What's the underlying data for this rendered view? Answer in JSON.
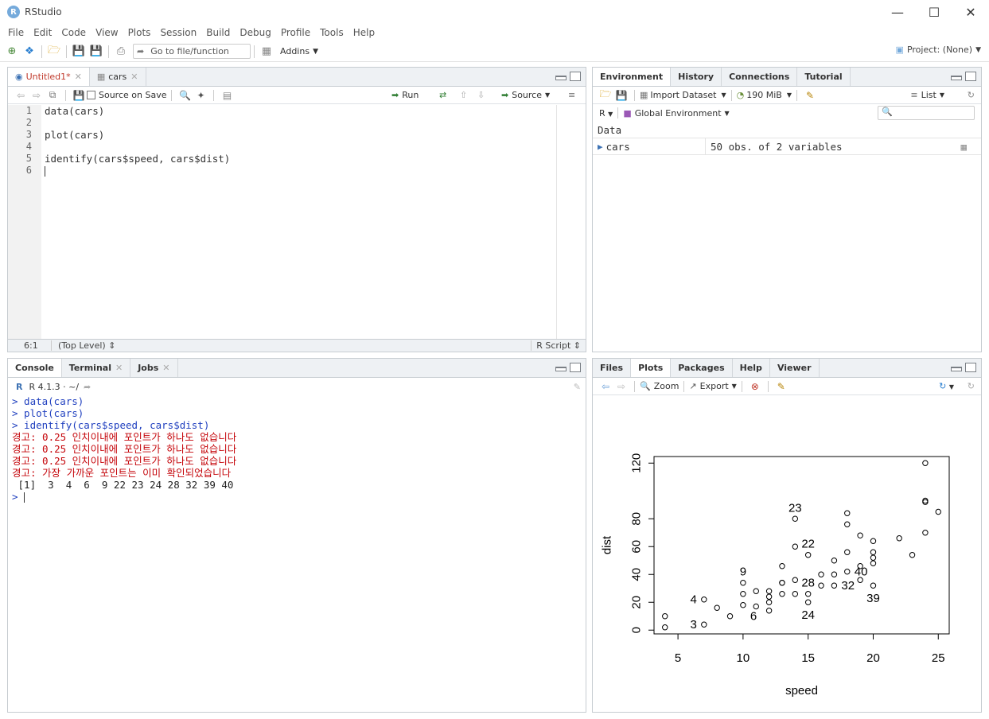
{
  "window": {
    "title": "RStudio",
    "app_icon": "R"
  },
  "menu": [
    "File",
    "Edit",
    "Code",
    "View",
    "Plots",
    "Session",
    "Build",
    "Debug",
    "Profile",
    "Tools",
    "Help"
  ],
  "toolbar": {
    "goto_placeholder": "Go to file/function",
    "addins": "Addins",
    "project": "Project: (None)"
  },
  "source": {
    "tabs": [
      {
        "label": "Untitled1*",
        "active": true
      },
      {
        "label": "cars",
        "active": false
      }
    ],
    "toolbar": {
      "source_on_save": "Source on Save",
      "run": "Run",
      "source": "Source"
    },
    "lines": [
      "data(cars)",
      "",
      "plot(cars)",
      "",
      "identify(cars$speed, cars$dist)",
      ""
    ],
    "line_numbers": [
      "1",
      "2",
      "3",
      "4",
      "5",
      "6"
    ],
    "status": {
      "position": "6:1",
      "scope": "(Top Level)",
      "filetype": "R Script"
    }
  },
  "console": {
    "tabs": [
      "Console",
      "Terminal",
      "Jobs"
    ],
    "header": "R 4.1.3 · ~/",
    "lines": [
      {
        "type": "cmd",
        "text": "> data(cars)"
      },
      {
        "type": "cmd",
        "text": "> plot(cars)"
      },
      {
        "type": "cmd",
        "text": "> identify(cars$speed, cars$dist)"
      },
      {
        "type": "warn",
        "text": "경고: 0.25 인치이내에 포인트가 하나도 없습니다"
      },
      {
        "type": "warn",
        "text": "경고: 0.25 인치이내에 포인트가 하나도 없습니다"
      },
      {
        "type": "warn",
        "text": "경고: 0.25 인치이내에 포인트가 하나도 없습니다"
      },
      {
        "type": "warn",
        "text": "경고: 가장 가까운 포인트는 이미 확인되었습니다"
      },
      {
        "type": "out",
        "text": " [1]  3  4  6  9 22 23 24 28 32 39 40"
      },
      {
        "type": "cmd",
        "text": "> "
      }
    ]
  },
  "environment": {
    "tabs": [
      "Environment",
      "History",
      "Connections",
      "Tutorial"
    ],
    "import_dataset": "Import Dataset",
    "memory": "190 MiB",
    "view_mode": "List",
    "language": "R",
    "scope": "Global Environment",
    "section": "Data",
    "rows": [
      {
        "name": "cars",
        "value": "50 obs. of 2 variables"
      }
    ]
  },
  "plots": {
    "tabs": [
      "Files",
      "Plots",
      "Packages",
      "Help",
      "Viewer"
    ],
    "zoom": "Zoom",
    "export": "Export"
  },
  "chart_data": {
    "type": "scatter",
    "xlabel": "speed",
    "ylabel": "dist",
    "xlim": [
      4,
      25
    ],
    "ylim": [
      2,
      120
    ],
    "x_ticks": [
      5,
      10,
      15,
      20,
      25
    ],
    "y_ticks": [
      0,
      20,
      40,
      60,
      80,
      120
    ],
    "points": [
      [
        4,
        2
      ],
      [
        4,
        10
      ],
      [
        7,
        4
      ],
      [
        7,
        22
      ],
      [
        8,
        16
      ],
      [
        9,
        10
      ],
      [
        10,
        18
      ],
      [
        10,
        26
      ],
      [
        10,
        34
      ],
      [
        11,
        17
      ],
      [
        11,
        28
      ],
      [
        12,
        14
      ],
      [
        12,
        20
      ],
      [
        12,
        24
      ],
      [
        12,
        28
      ],
      [
        13,
        26
      ],
      [
        13,
        34
      ],
      [
        13,
        34
      ],
      [
        13,
        46
      ],
      [
        14,
        26
      ],
      [
        14,
        36
      ],
      [
        14,
        60
      ],
      [
        14,
        80
      ],
      [
        15,
        20
      ],
      [
        15,
        26
      ],
      [
        15,
        54
      ],
      [
        16,
        32
      ],
      [
        16,
        40
      ],
      [
        17,
        32
      ],
      [
        17,
        40
      ],
      [
        17,
        50
      ],
      [
        18,
        42
      ],
      [
        18,
        56
      ],
      [
        18,
        76
      ],
      [
        18,
        84
      ],
      [
        19,
        36
      ],
      [
        19,
        46
      ],
      [
        19,
        68
      ],
      [
        20,
        32
      ],
      [
        20,
        48
      ],
      [
        20,
        52
      ],
      [
        20,
        56
      ],
      [
        20,
        64
      ],
      [
        22,
        66
      ],
      [
        23,
        54
      ],
      [
        24,
        70
      ],
      [
        24,
        92
      ],
      [
        24,
        93
      ],
      [
        24,
        120
      ],
      [
        25,
        85
      ]
    ],
    "labels": [
      {
        "text": "3",
        "x": 7,
        "y": 4,
        "pos": "left"
      },
      {
        "text": "4",
        "x": 7,
        "y": 22,
        "pos": "left"
      },
      {
        "text": "6",
        "x": 10,
        "y": 10,
        "pos": "right"
      },
      {
        "text": "9",
        "x": 10,
        "y": 34,
        "pos": "above"
      },
      {
        "text": "22",
        "x": 15,
        "y": 54,
        "pos": "above"
      },
      {
        "text": "23",
        "x": 14,
        "y": 80,
        "pos": "above"
      },
      {
        "text": "24",
        "x": 15,
        "y": 20,
        "pos": "below"
      },
      {
        "text": "28",
        "x": 15,
        "y": 26,
        "pos": "above"
      },
      {
        "text": "32",
        "x": 17,
        "y": 32,
        "pos": "right"
      },
      {
        "text": "39",
        "x": 20,
        "y": 32,
        "pos": "below"
      },
      {
        "text": "40",
        "x": 18,
        "y": 42,
        "pos": "right"
      }
    ]
  }
}
